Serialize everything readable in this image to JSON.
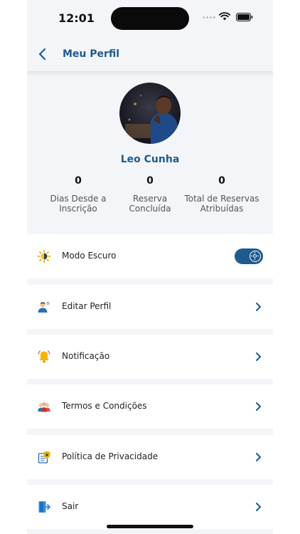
{
  "status_bar": {
    "time": "12:01"
  },
  "header": {
    "title": "Meu Perfil",
    "back_icon": "chevron-left-icon"
  },
  "profile": {
    "name": "Leo Cunha",
    "avatar": "avatar-photo",
    "stats": [
      {
        "value": "0",
        "label": "Dias Desde a Inscrição"
      },
      {
        "value": "0",
        "label": "Reserva Concluída"
      },
      {
        "value": "0",
        "label": "Total de Reservas Atribuídas"
      }
    ]
  },
  "menu": {
    "dark_mode": {
      "label": "Modo Escuro",
      "icon": "sun-icon",
      "toggle_on": true
    },
    "items": [
      {
        "label": "Editar Perfil",
        "icon": "user-edit-icon"
      },
      {
        "label": "Notificação",
        "icon": "bell-icon"
      },
      {
        "label": "Termos e Condições",
        "icon": "people-icon"
      },
      {
        "label": "Política de Privacidade",
        "icon": "privacy-icon"
      },
      {
        "label": "Sair",
        "icon": "logout-icon"
      }
    ]
  },
  "colors": {
    "accent": "#1e5a8e",
    "background": "#f3f5f8",
    "card": "#ffffff"
  }
}
